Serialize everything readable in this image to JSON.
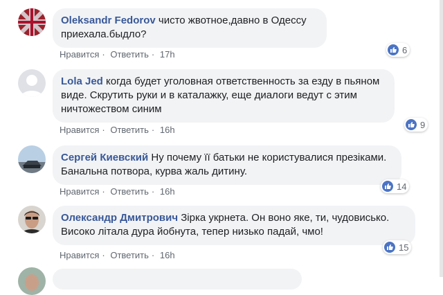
{
  "comments": [
    {
      "author": "Oleksandr Fedorov",
      "text": "чисто жвотное,давно в Одессу приехала.быдло?",
      "like": "Нравится",
      "reply": "Ответить",
      "time": "17h",
      "reactions": "6"
    },
    {
      "author": "Lola Jed",
      "text": "когда будет уголовная ответственность за езду в пьяном виде. Скрутить руки и в каталажку, еще диалоги ведут с этим ничтожеством синим",
      "like": "Нравится",
      "reply": "Ответить",
      "time": "16h",
      "reactions": "9"
    },
    {
      "author": "Сергей Киевский",
      "text": "Ну почему її батьки не користувалися презіками. Банальна потвора, курва жаль дитину.",
      "like": "Нравится",
      "reply": "Ответить",
      "time": "16h",
      "reactions": "14"
    },
    {
      "author": "Олександр Дмитрович",
      "text": "Зірка укрнета. Он воно яке, ти, чудовисько. Високо літала дура йобнута, тепер низько падай, чмо!",
      "like": "Нравится",
      "reply": "Ответить",
      "time": "16h",
      "reactions": "15"
    }
  ],
  "colors": {
    "link": "#385898",
    "bubble": "#f2f3f5",
    "like": "#4b74c4"
  }
}
